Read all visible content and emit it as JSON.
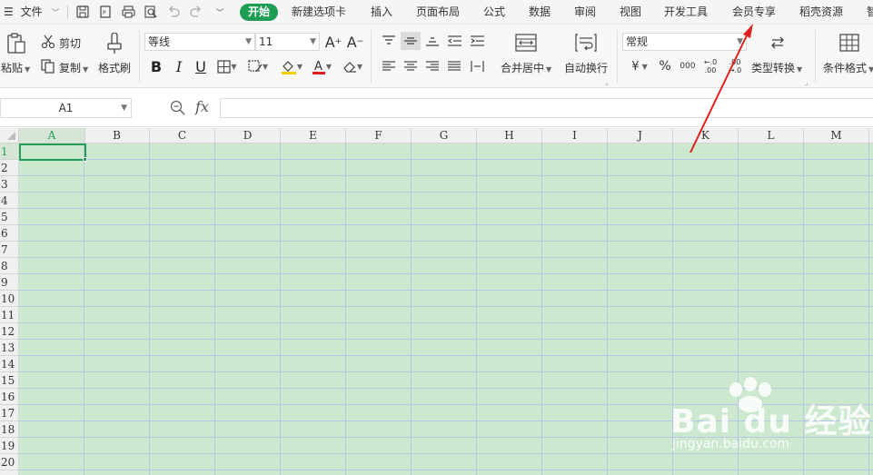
{
  "menu": {
    "file_label": "文件",
    "tabs": [
      "开始",
      "新建选项卡",
      "插入",
      "页面布局",
      "公式",
      "数据",
      "审阅",
      "视图",
      "开发工具",
      "会员专享",
      "稻壳资源",
      "智"
    ],
    "active_tab": "开始"
  },
  "ribbon": {
    "paste": "粘贴",
    "cut": "剪切",
    "copy": "复制",
    "format_painter": "格式刷",
    "font_name": "等线",
    "font_size": "11",
    "merge_center": "合并居中",
    "wrap_text": "自动换行",
    "number_format": "常规",
    "type_convert": "类型转换",
    "conditional_format": "条件格式",
    "currency_symbol": "¥",
    "percent_symbol": "%",
    "thousands_symbol": "000",
    "inc_decimal": "+.0 .00",
    "dec_decimal": ".00 →.0"
  },
  "formula_bar": {
    "name_box": "A1",
    "fx": "fx",
    "value": ""
  },
  "grid": {
    "columns": [
      "A",
      "B",
      "C",
      "D",
      "E",
      "F",
      "G",
      "H",
      "I",
      "J",
      "K",
      "L",
      "M"
    ],
    "rows": [
      "1",
      "2",
      "3",
      "4",
      "5",
      "6",
      "7",
      "8",
      "9",
      "10",
      "11",
      "12",
      "13",
      "14",
      "15",
      "16",
      "17",
      "18",
      "19",
      "20"
    ],
    "selected_cell": "A1"
  },
  "watermark": {
    "brand": "Bai du 经验",
    "url": "jingyan.baidu.com"
  },
  "colors": {
    "accent": "#1f9d55",
    "sheet_bg": "#cce8cf",
    "gridline": "#b8c6e6",
    "annotation_arrow": "#e02020"
  }
}
